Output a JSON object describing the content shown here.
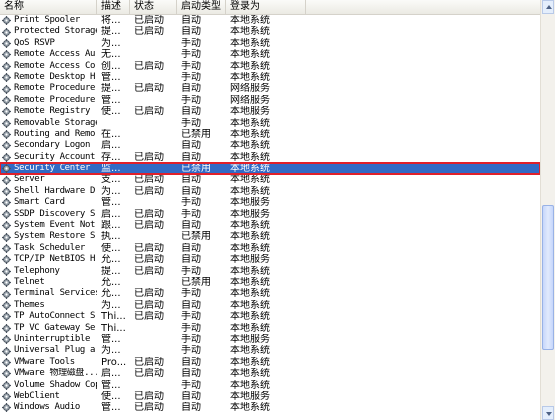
{
  "columns": {
    "name": "名称",
    "description": "描述",
    "status": "状态",
    "startup_type": "启动类型",
    "logon_as": "登录为"
  },
  "rows": [
    {
      "name": "Print Spooler",
      "description": "将...",
      "status": "已启动",
      "startup_type": "自动",
      "logon_as": "本地系统"
    },
    {
      "name": "Protected Storage",
      "description": "提...",
      "status": "已启动",
      "startup_type": "自动",
      "logon_as": "本地系统"
    },
    {
      "name": "QoS RSVP",
      "description": "为...",
      "status": "",
      "startup_type": "手动",
      "logon_as": "本地系统"
    },
    {
      "name": "Remote Access Au...",
      "description": "无...",
      "status": "",
      "startup_type": "手动",
      "logon_as": "本地系统"
    },
    {
      "name": "Remote Access Co...",
      "description": "创...",
      "status": "已启动",
      "startup_type": "手动",
      "logon_as": "本地系统"
    },
    {
      "name": "Remote Desktop H...",
      "description": "管...",
      "status": "",
      "startup_type": "手动",
      "logon_as": "本地系统"
    },
    {
      "name": "Remote Procedure...",
      "description": "提...",
      "status": "已启动",
      "startup_type": "自动",
      "logon_as": "网络服务"
    },
    {
      "name": "Remote Procedure...",
      "description": "管...",
      "status": "",
      "startup_type": "手动",
      "logon_as": "网络服务"
    },
    {
      "name": "Remote Registry",
      "description": "使...",
      "status": "已启动",
      "startup_type": "自动",
      "logon_as": "本地服务"
    },
    {
      "name": "Removable Storage",
      "description": "",
      "status": "",
      "startup_type": "手动",
      "logon_as": "本地系统"
    },
    {
      "name": "Routing and Remo...",
      "description": "在...",
      "status": "",
      "startup_type": "已禁用",
      "logon_as": "本地系统"
    },
    {
      "name": "Secondary Logon",
      "description": "启...",
      "status": "",
      "startup_type": "自动",
      "logon_as": "本地系统"
    },
    {
      "name": "Security Account...",
      "description": "存...",
      "status": "已启动",
      "startup_type": "自动",
      "logon_as": "本地系统"
    },
    {
      "name": "Security Center",
      "description": "监...",
      "status": "",
      "startup_type": "已禁用",
      "logon_as": "本地系统",
      "selected": true
    },
    {
      "name": "Server",
      "description": "支...",
      "status": "已启动",
      "startup_type": "自动",
      "logon_as": "本地系统"
    },
    {
      "name": "Shell Hardware D...",
      "description": "为...",
      "status": "已启动",
      "startup_type": "自动",
      "logon_as": "本地系统"
    },
    {
      "name": "Smart Card",
      "description": "管...",
      "status": "",
      "startup_type": "手动",
      "logon_as": "本地服务"
    },
    {
      "name": "SSDP Discovery S...",
      "description": "启...",
      "status": "已启动",
      "startup_type": "手动",
      "logon_as": "本地服务"
    },
    {
      "name": "System Event Not...",
      "description": "跟...",
      "status": "已启动",
      "startup_type": "自动",
      "logon_as": "本地系统"
    },
    {
      "name": "System Restore S...",
      "description": "执...",
      "status": "",
      "startup_type": "已禁用",
      "logon_as": "本地系统"
    },
    {
      "name": "Task Scheduler",
      "description": "使...",
      "status": "已启动",
      "startup_type": "自动",
      "logon_as": "本地系统"
    },
    {
      "name": "TCP/IP NetBIOS H...",
      "description": "允...",
      "status": "已启动",
      "startup_type": "自动",
      "logon_as": "本地服务"
    },
    {
      "name": "Telephony",
      "description": "提...",
      "status": "已启动",
      "startup_type": "手动",
      "logon_as": "本地系统"
    },
    {
      "name": "Telnet",
      "description": "允...",
      "status": "",
      "startup_type": "已禁用",
      "logon_as": "本地系统"
    },
    {
      "name": "Terminal Services",
      "description": "允...",
      "status": "已启动",
      "startup_type": "手动",
      "logon_as": "本地系统"
    },
    {
      "name": "Themes",
      "description": "为...",
      "status": "已启动",
      "startup_type": "自动",
      "logon_as": "本地系统"
    },
    {
      "name": "TP AutoConnect S...",
      "description": "Thi...",
      "status": "已启动",
      "startup_type": "手动",
      "logon_as": "本地系统"
    },
    {
      "name": "TP VC Gateway Se...",
      "description": "Thi...",
      "status": "",
      "startup_type": "手动",
      "logon_as": "本地系统"
    },
    {
      "name": "Uninterruptible ...",
      "description": "管...",
      "status": "",
      "startup_type": "手动",
      "logon_as": "本地服务"
    },
    {
      "name": "Universal Plug a...",
      "description": "为...",
      "status": "",
      "startup_type": "手动",
      "logon_as": "本地系统"
    },
    {
      "name": "VMware Tools",
      "description": "Pro...",
      "status": "已启动",
      "startup_type": "自动",
      "logon_as": "本地系统"
    },
    {
      "name": "VMware 物理磁盘...",
      "description": "启...",
      "status": "已启动",
      "startup_type": "自动",
      "logon_as": "本地系统"
    },
    {
      "name": "Volume Shadow Copy",
      "description": "管...",
      "status": "",
      "startup_type": "手动",
      "logon_as": "本地系统"
    },
    {
      "name": "WebClient",
      "description": "使...",
      "status": "已启动",
      "startup_type": "自动",
      "logon_as": "本地服务"
    },
    {
      "name": "Windows Audio",
      "description": "管...",
      "status": "已启动",
      "startup_type": "自动",
      "logon_as": "本地系统"
    }
  ],
  "colors": {
    "selection_bg": "#316ac5",
    "highlight_box": "#e0202a"
  },
  "row_icon": "service-gear-icon"
}
